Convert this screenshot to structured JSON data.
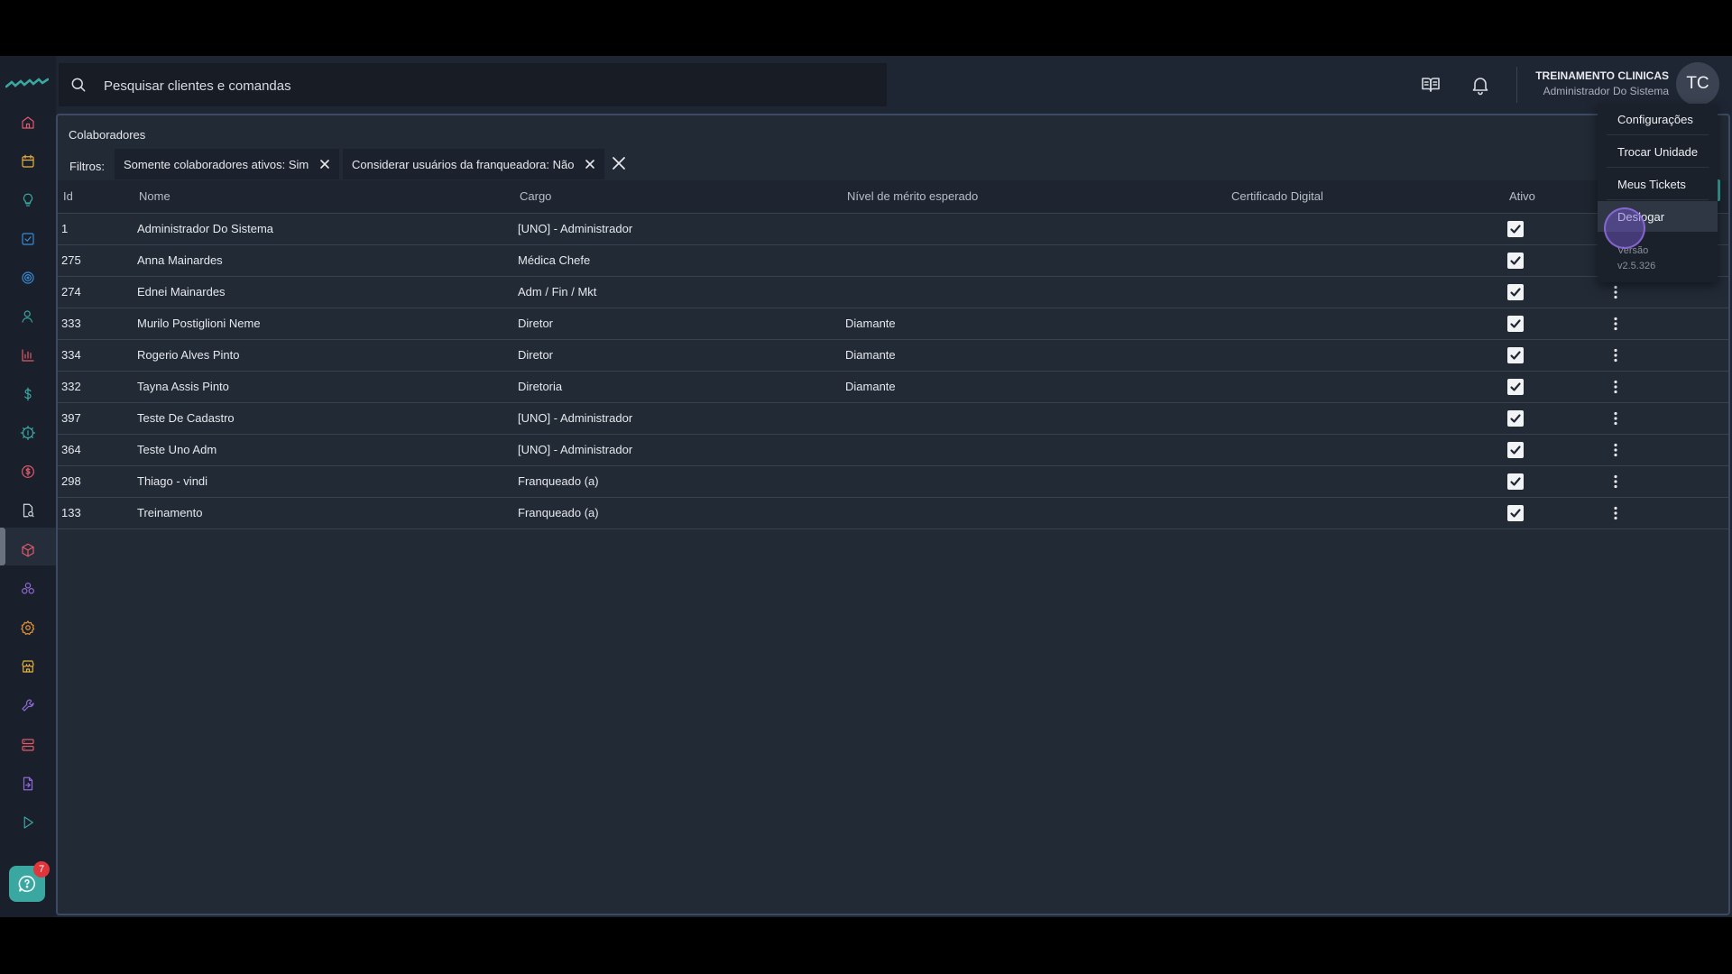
{
  "search": {
    "placeholder": "Pesquisar clientes e comandas"
  },
  "user": {
    "name": "TREINAMENTO CLINICAS",
    "role": "Administrador Do Sistema",
    "initials": "TC"
  },
  "help": {
    "badge_count": "7"
  },
  "page": {
    "title": "Colaboradores",
    "filters_label": "Filtros:",
    "filters": [
      "Somente colaboradores ativos: Sim",
      "Considerar usuários da franqueadora: Não"
    ]
  },
  "table": {
    "headers": [
      "Id",
      "Nome",
      "Cargo",
      "Nível de mérito esperado",
      "Certificado Digital",
      "Ativo"
    ],
    "rows": [
      {
        "id": "1",
        "nome": "Administrador Do Sistema",
        "cargo": "[UNO] - Administrador",
        "nivel": "",
        "cert": "",
        "ativo": true
      },
      {
        "id": "275",
        "nome": "Anna Mainardes",
        "cargo": "Médica Chefe",
        "nivel": "",
        "cert": "",
        "ativo": true
      },
      {
        "id": "274",
        "nome": "Ednei Mainardes",
        "cargo": "Adm / Fin / Mkt",
        "nivel": "",
        "cert": "",
        "ativo": true
      },
      {
        "id": "333",
        "nome": "Murilo Postiglioni Neme",
        "cargo": "Diretor",
        "nivel": "Diamante",
        "cert": "",
        "ativo": true
      },
      {
        "id": "334",
        "nome": "Rogerio Alves Pinto",
        "cargo": "Diretor",
        "nivel": "Diamante",
        "cert": "",
        "ativo": true
      },
      {
        "id": "332",
        "nome": "Tayna Assis Pinto",
        "cargo": "Diretoria",
        "nivel": "Diamante",
        "cert": "",
        "ativo": true
      },
      {
        "id": "397",
        "nome": "Teste De Cadastro",
        "cargo": "[UNO] - Administrador",
        "nivel": "",
        "cert": "",
        "ativo": true
      },
      {
        "id": "364",
        "nome": "Teste Uno Adm",
        "cargo": "[UNO] - Administrador",
        "nivel": "",
        "cert": "",
        "ativo": true
      },
      {
        "id": "298",
        "nome": "Thiago - vindi",
        "cargo": "Franqueado (a)",
        "nivel": "",
        "cert": "",
        "ativo": true
      },
      {
        "id": "133",
        "nome": "Treinamento",
        "cargo": "Franqueado (a)",
        "nivel": "",
        "cert": "",
        "ativo": true
      }
    ]
  },
  "menu": {
    "items": [
      "Configurações",
      "Trocar Unidade",
      "Meus Tickets",
      "Deslogar"
    ],
    "version_label": "Versão",
    "version": "v2.5.326"
  },
  "sidebar": {
    "icons": [
      {
        "name": "home-icon",
        "color": "#e05a6a"
      },
      {
        "name": "calendar-icon",
        "color": "#e8b23a"
      },
      {
        "name": "lightbulb-icon",
        "color": "#3aa7a0"
      },
      {
        "name": "checklist-icon",
        "color": "#3a8bd6"
      },
      {
        "name": "target-icon",
        "color": "#3a8bd6"
      },
      {
        "name": "user-icon",
        "color": "#3aa7a0"
      },
      {
        "name": "bar-chart-icon",
        "color": "#e05a6a"
      },
      {
        "name": "dollar-icon",
        "color": "#3aa7a0"
      },
      {
        "name": "gear-dollar-icon",
        "color": "#3aa7a0"
      },
      {
        "name": "coin-icon",
        "color": "#e05a6a"
      },
      {
        "name": "document-search-icon",
        "color": "#d7dae0"
      },
      {
        "name": "package-icon",
        "color": "#e05a6a"
      },
      {
        "name": "modules-icon",
        "color": "#8f6ad6"
      },
      {
        "name": "settings-icon",
        "color": "#e8963a"
      },
      {
        "name": "store-icon",
        "color": "#e8b23a"
      },
      {
        "name": "wrench-icon",
        "color": "#8f6ad6"
      },
      {
        "name": "server-icon",
        "color": "#e05a6a"
      },
      {
        "name": "file-export-icon",
        "color": "#8f6ad6"
      },
      {
        "name": "play-icon",
        "color": "#3aa7a0"
      }
    ]
  }
}
